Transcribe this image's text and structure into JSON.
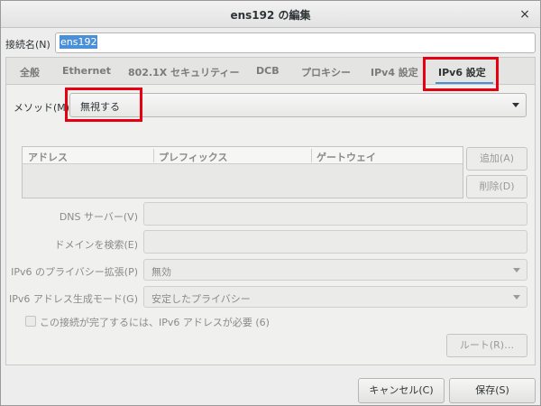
{
  "window": {
    "title": "ens192 の編集",
    "close_glyph": "×"
  },
  "connection": {
    "label": "接続名(N)",
    "value": "ens192"
  },
  "tabs": [
    {
      "label": "全般"
    },
    {
      "label": "Ethernet"
    },
    {
      "label": "802.1X セキュリティー"
    },
    {
      "label": "DCB"
    },
    {
      "label": "プロキシー"
    },
    {
      "label": "IPv4 設定"
    },
    {
      "label": "IPv6 設定",
      "active": true
    }
  ],
  "method": {
    "label": "メソッド(M)",
    "value": "無視する"
  },
  "addresses": {
    "columns": [
      "アドレス",
      "プレフィックス",
      "ゲートウェイ"
    ],
    "add_label": "追加(A)",
    "delete_label": "削除(D)"
  },
  "form": {
    "dns_label": "DNS サーバー(V)",
    "search_label": "ドメインを検索(E)",
    "privacy_label": "IPv6 のプライバシー拡張(P)",
    "privacy_value": "無効",
    "addrgen_label": "IPv6 アドレス生成モード(G)",
    "addrgen_value": "安定したプライバシー",
    "require_label": "この接続が完了するには、IPv6 アドレスが必要 (6)",
    "routes_label": "ルート(R)…"
  },
  "footer": {
    "cancel_label": "キャンセル(C)",
    "save_label": "保存(S)"
  },
  "colors": {
    "highlight": "#e60012",
    "accent": "#4a90d9"
  }
}
